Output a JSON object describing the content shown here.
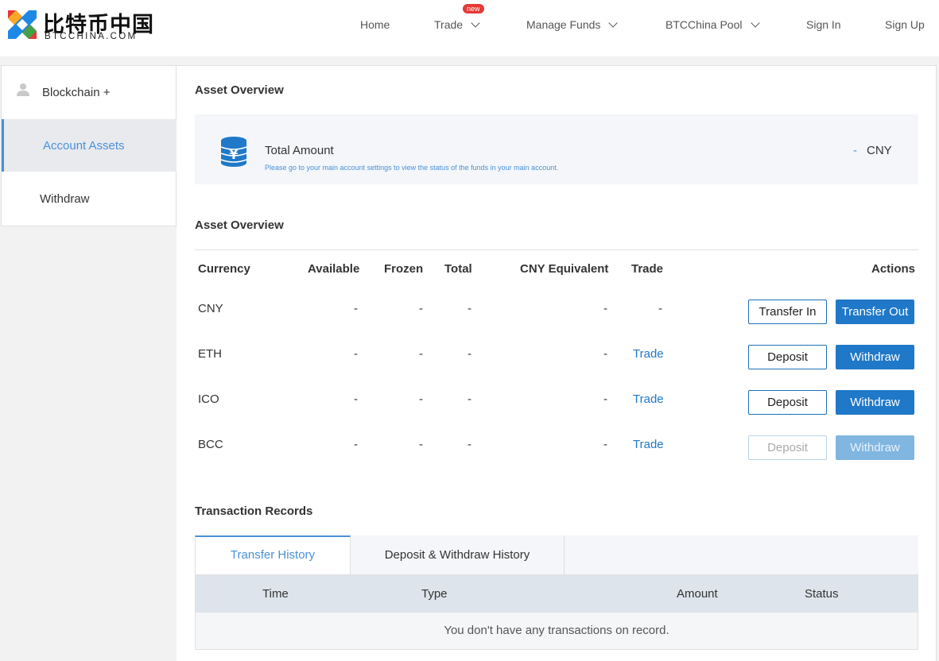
{
  "brand": {
    "name_cn": "比特币中国",
    "name_en": "BTCCHINA.COM"
  },
  "nav": {
    "home": "Home",
    "trade": "Trade",
    "trade_badge": "new",
    "manage_funds": "Manage Funds",
    "pool": "BTCChina Pool",
    "sign_in": "Sign In",
    "sign_up": "Sign Up"
  },
  "sidebar": {
    "user": "Blockchain +",
    "items": [
      {
        "label": "Account Assets",
        "active": true
      },
      {
        "label": "Withdraw",
        "active": false
      }
    ]
  },
  "overview": {
    "title": "Asset Overview",
    "total_label": "Total Amount",
    "total_hint": "Please go to your main account settings to view the status of the funds in your main account.",
    "total_value": "-",
    "total_currency": "CNY"
  },
  "assets": {
    "title": "Asset Overview",
    "headers": {
      "currency": "Currency",
      "available": "Available",
      "frozen": "Frozen",
      "total": "Total",
      "cny_equiv": "CNY Equivalent",
      "trade": "Trade",
      "actions": "Actions"
    },
    "rows": [
      {
        "currency": "CNY",
        "available": "-",
        "frozen": "-",
        "total": "-",
        "cny": "-",
        "trade": "-",
        "btn1": "Transfer In",
        "btn2": "Transfer Out"
      },
      {
        "currency": "ETH",
        "available": "-",
        "frozen": "-",
        "total": "-",
        "cny": "-",
        "trade": "Trade",
        "btn1": "Deposit",
        "btn2": "Withdraw"
      },
      {
        "currency": "ICO",
        "available": "-",
        "frozen": "-",
        "total": "-",
        "cny": "-",
        "trade": "Trade",
        "btn1": "Deposit",
        "btn2": "Withdraw"
      },
      {
        "currency": "BCC",
        "available": "-",
        "frozen": "-",
        "total": "-",
        "cny": "-",
        "trade": "Trade",
        "btn1": "Deposit",
        "btn2": "Withdraw"
      }
    ]
  },
  "transactions": {
    "title": "Transaction Records",
    "tabs": [
      "Transfer History",
      "Deposit & Withdraw History"
    ],
    "columns": [
      "Time",
      "Type",
      "Amount",
      "Status"
    ],
    "empty": "You don't have any transactions on record."
  },
  "colors": {
    "accent": "#1f78c8",
    "link": "#4a90d9",
    "badge": "#e53935"
  }
}
